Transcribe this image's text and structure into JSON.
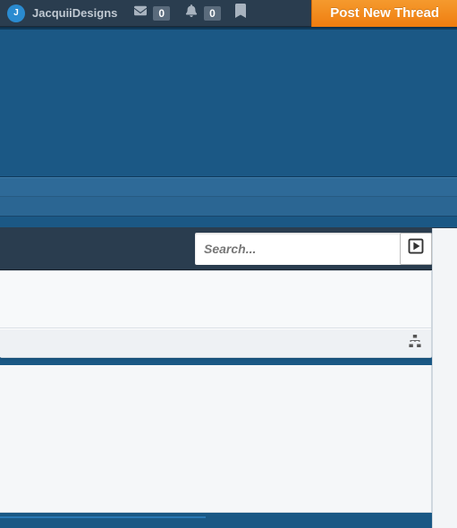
{
  "colors": {
    "accent": "#f38c1e",
    "bar": "#2a3d4f",
    "page": "#1a5885"
  },
  "user": {
    "name": "JacquiiDesigns",
    "avatar_initial": "J"
  },
  "nav": {
    "messages_count": "0",
    "alerts_count": "0"
  },
  "post_button": {
    "label": "Post New Thread"
  },
  "search": {
    "placeholder": "Search..."
  }
}
